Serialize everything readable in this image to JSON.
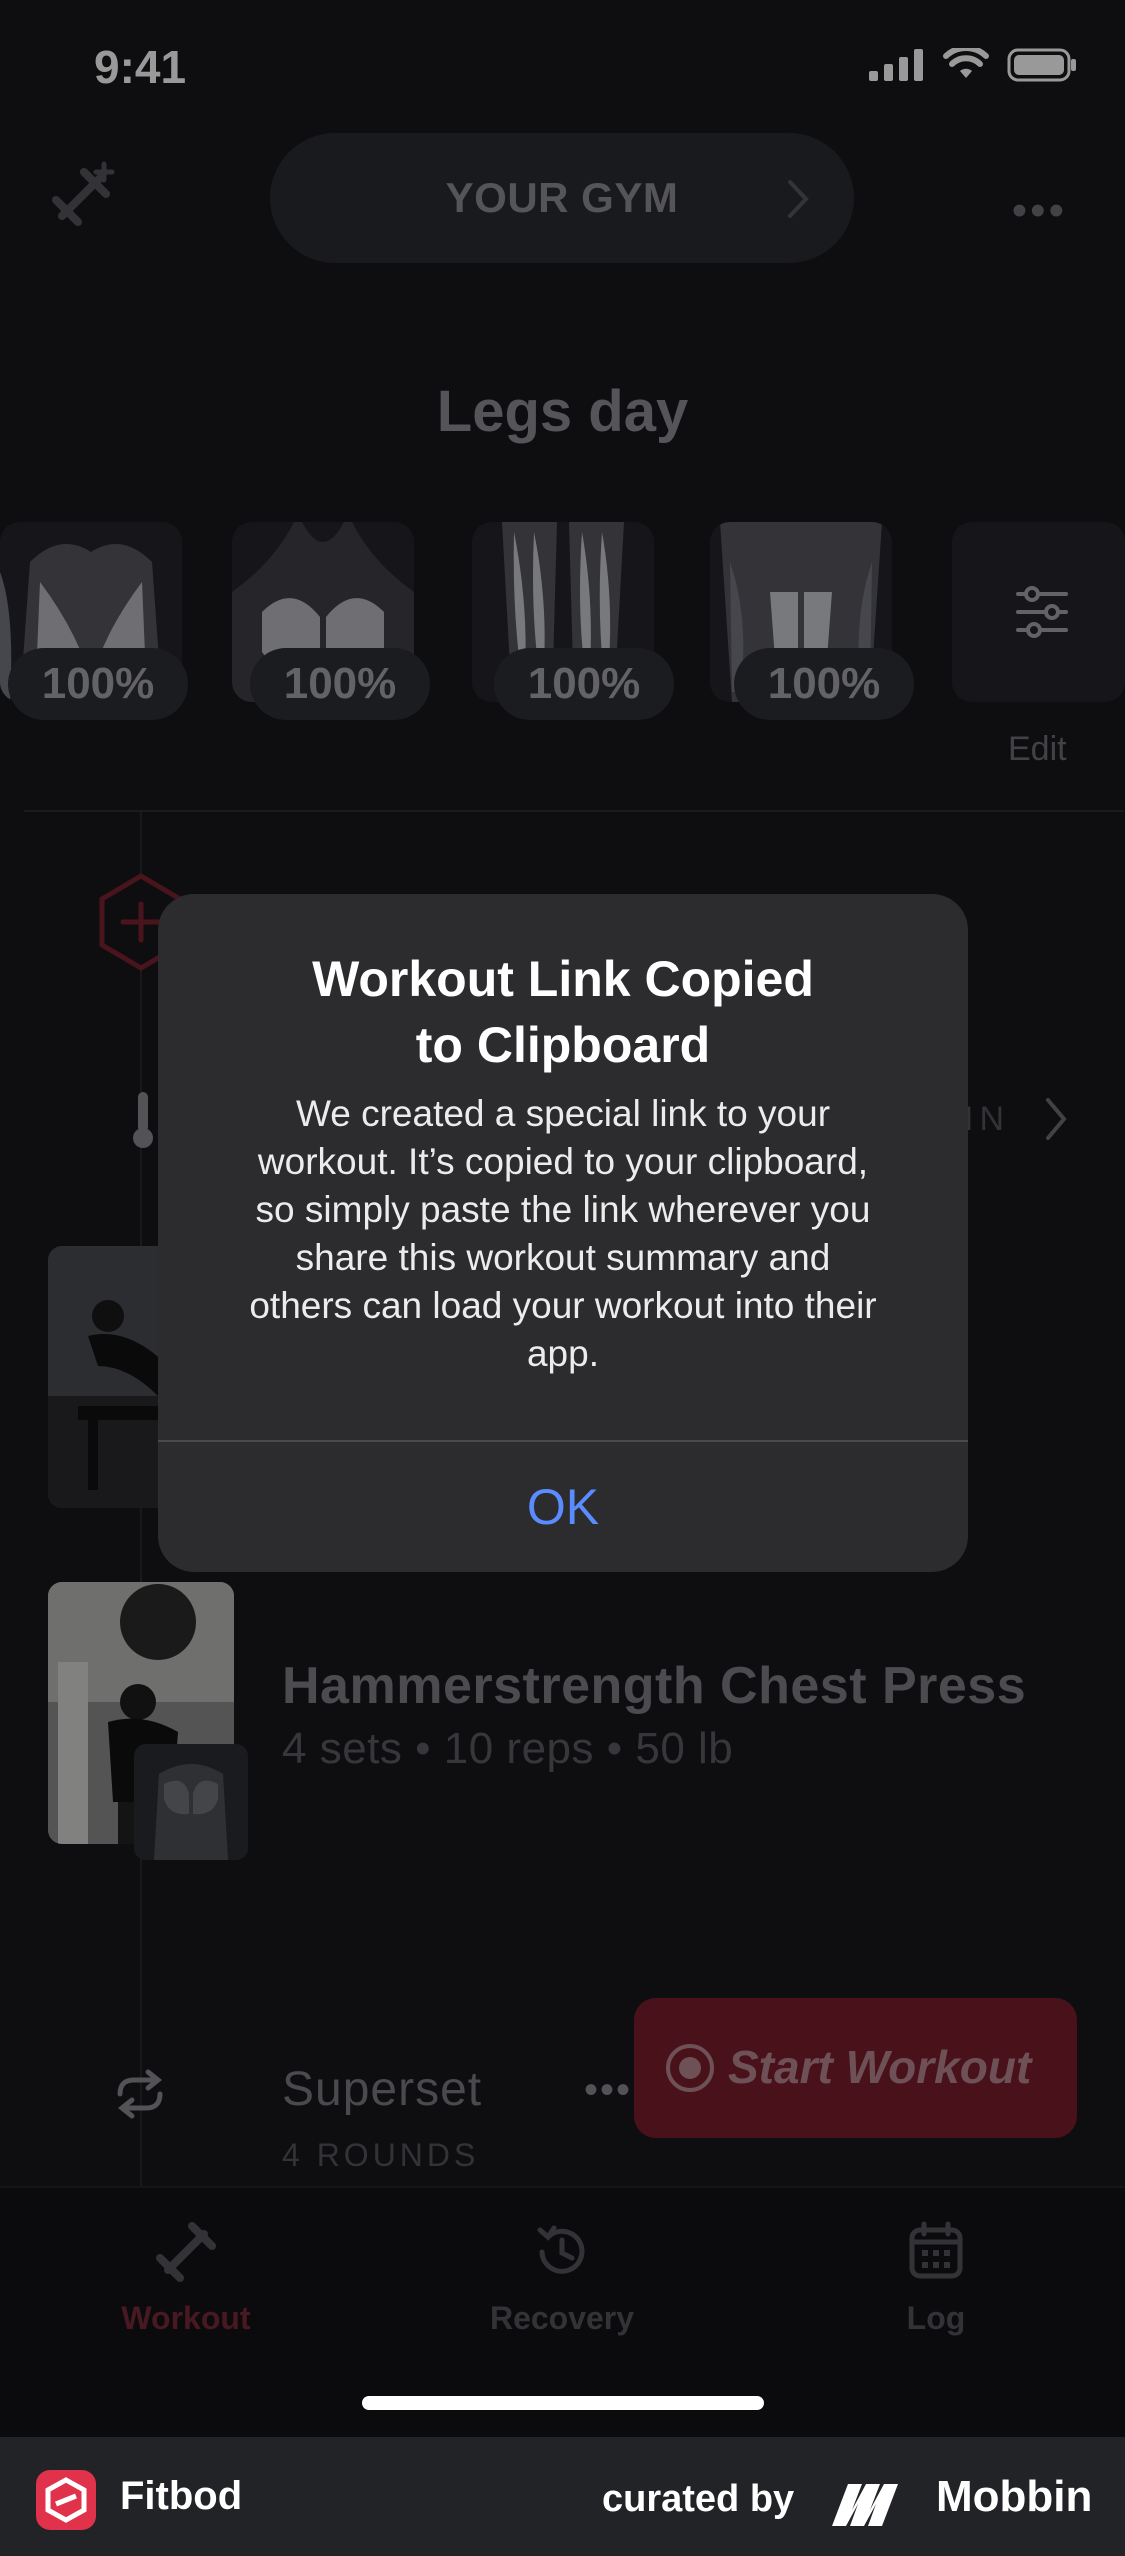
{
  "status_bar": {
    "time": "9:41"
  },
  "header": {
    "gym_label": "YOUR GYM"
  },
  "workout": {
    "title": "Legs day",
    "muscles": [
      {
        "name": "back",
        "recovery": "100%"
      },
      {
        "name": "chest",
        "recovery": "100%"
      },
      {
        "name": "quads",
        "recovery": "100%"
      },
      {
        "name": "hamstrings",
        "recovery": "100%"
      }
    ],
    "edit_label": "Edit",
    "exercises": [
      {
        "name": "Hammerstrength Chest Press",
        "detail": "4 sets • 10 reps • 50 lb"
      }
    ],
    "superset": {
      "label": "Superset",
      "rounds": "4 ROUNDS"
    },
    "start_button": "Start Workout",
    "warmup_fragment": "IN"
  },
  "tabs": [
    {
      "label": "Workout",
      "icon": "dumbbell-icon",
      "active": true
    },
    {
      "label": "Recovery",
      "icon": "clock-icon",
      "active": false
    },
    {
      "label": "Log",
      "icon": "calendar-icon",
      "active": false
    }
  ],
  "dialog": {
    "title": "Workout Link Copied to Clipboard",
    "title_line1": "Workout Link Copied",
    "title_line2": "to Clipboard",
    "body_lines": [
      "We created a special link to your",
      "workout. It’s copied to your clipboard,",
      "so simply paste the link wherever you",
      "share this workout summary and",
      "others can load your workout into their",
      "app."
    ],
    "ok_label": "OK"
  },
  "footer": {
    "app_name": "Fitbod",
    "curated_by": "curated by",
    "brand": "Mobbin"
  },
  "colors": {
    "accent": "#e0324a",
    "dialog_button": "#5b8cff",
    "background": "#18181d"
  }
}
